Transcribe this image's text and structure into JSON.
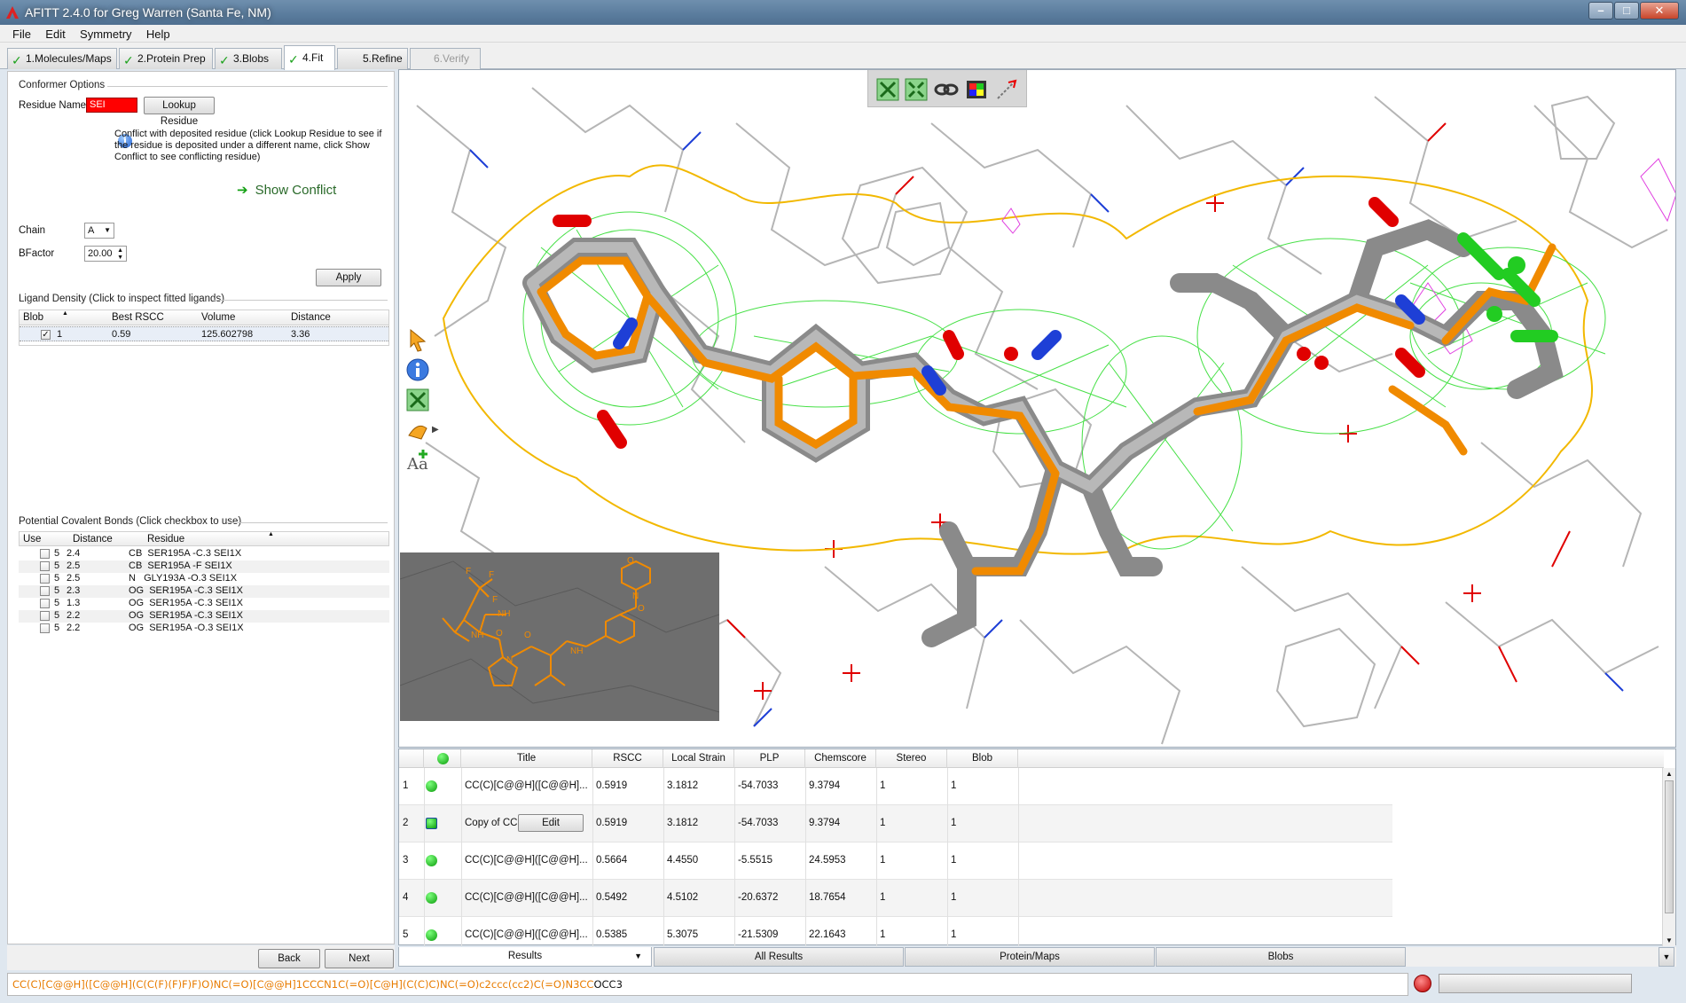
{
  "window": {
    "title": "AFITT 2.4.0 for Greg Warren (Santa Fe, NM)",
    "min": "–",
    "max": "□",
    "close": "✕"
  },
  "menu": [
    "File",
    "Edit",
    "Symmetry",
    "Help"
  ],
  "steps": [
    {
      "label": "1.Molecules/Maps",
      "checked": true
    },
    {
      "label": "2.Protein Prep",
      "checked": true
    },
    {
      "label": "3.Blobs",
      "checked": true
    },
    {
      "label": "4.Fit",
      "checked": true
    },
    {
      "label": "5.Refine",
      "checked": false
    },
    {
      "label": "6.Verify",
      "checked": false
    }
  ],
  "conformer": {
    "section_title": "Conformer Options",
    "residue_label": "Residue Name",
    "residue_value": "SEI",
    "lookup_button": "Lookup Residue",
    "info_text": "Conflict with deposited residue (click Lookup Residue to see if the residue is deposited under a different name, click Show Conflict to see conflicting residue)",
    "show_conflict": "Show Conflict",
    "chain_label": "Chain",
    "chain_value": "A",
    "bfactor_label": "BFactor",
    "bfactor_value": "20.00",
    "apply_button": "Apply"
  },
  "density": {
    "section_title": "Ligand Density (Click to inspect fitted ligands)",
    "columns": [
      "Blob",
      "Best RSCC",
      "Volume",
      "Distance"
    ],
    "rows": [
      {
        "blob": "1",
        "rscc": "0.59",
        "volume": "125.602798",
        "distance": "3.36",
        "checked": true
      }
    ]
  },
  "covalent": {
    "section_title": "Potential Covalent Bonds (Click checkbox to use)",
    "columns": [
      "Use",
      "Distance",
      "Residue"
    ],
    "rows": [
      {
        "n": "5",
        "dist": "2.4",
        "residue": "CB  SER195A -C.3 SEI1X"
      },
      {
        "n": "5",
        "dist": "2.5",
        "residue": "CB  SER195A -F SEI1X"
      },
      {
        "n": "5",
        "dist": "2.5",
        "residue": "N   GLY193A -O.3 SEI1X"
      },
      {
        "n": "5",
        "dist": "2.3",
        "residue": "OG  SER195A -C.3 SEI1X"
      },
      {
        "n": "5",
        "dist": "1.3",
        "residue": "OG  SER195A -C.3 SEI1X"
      },
      {
        "n": "5",
        "dist": "2.2",
        "residue": "OG  SER195A -C.3 SEI1X"
      },
      {
        "n": "5",
        "dist": "2.2",
        "residue": "OG  SER195A -O.3 SEI1X"
      }
    ]
  },
  "nav": {
    "back": "Back",
    "next": "Next"
  },
  "sketch_labels": {
    "F1": "F",
    "F2": "F",
    "F3": "F",
    "NH1": "NH",
    "NH2": "NH",
    "NH3": "NH",
    "N1": "N",
    "N2": "N",
    "O1": "O",
    "O2": "O",
    "O3": "O",
    "O4": "O"
  },
  "results": {
    "columns": [
      "",
      "Title",
      "RSCC",
      "Local Strain",
      "PLP",
      "Chemscore",
      "Stereo",
      "Blob"
    ],
    "edit_button": "Edit",
    "rows": [
      {
        "idx": "1",
        "title": "CC(C)[C@@H]([C@@H]...",
        "rscc": "0.5919",
        "strain": "3.1812",
        "plp": "-54.7033",
        "chem": "9.3794",
        "stereo": "1",
        "blob": "1"
      },
      {
        "idx": "2",
        "title": "Copy of CC(C",
        "rscc": "0.5919",
        "strain": "3.1812",
        "plp": "-54.7033",
        "chem": "9.3794",
        "stereo": "1",
        "blob": "1"
      },
      {
        "idx": "3",
        "title": "CC(C)[C@@H]([C@@H]...",
        "rscc": "0.5664",
        "strain": "4.4550",
        "plp": "-5.5515",
        "chem": "24.5953",
        "stereo": "1",
        "blob": "1"
      },
      {
        "idx": "4",
        "title": "CC(C)[C@@H]([C@@H]...",
        "rscc": "0.5492",
        "strain": "4.5102",
        "plp": "-20.6372",
        "chem": "18.7654",
        "stereo": "1",
        "blob": "1"
      },
      {
        "idx": "5",
        "title": "CC(C)[C@@H]([C@@H]...",
        "rscc": "0.5385",
        "strain": "5.3075",
        "plp": "-21.5309",
        "chem": "22.1643",
        "stereo": "1",
        "blob": "1"
      }
    ]
  },
  "bottom_tabs": [
    "Results",
    "All Results",
    "Protein/Maps",
    "Blobs"
  ],
  "smiles": {
    "colored": "CC(C)[C@@H]([C@@H](C(C(F)(F)F)F)O)NC(=O)[C@@H]1CCCN1C(=O)[C@H](C(C)C)NC(=O)c2ccc(cc2)C(=O)N3CC",
    "tail": "OCC3"
  },
  "colors": {
    "accent_orange": "#f08a00",
    "density_green": "#33dd33",
    "carbon_grey": "#9a9a9a",
    "oxygen_red": "#e00000",
    "nitrogen_blue": "#1e3fd6",
    "contour_yellow": "#f2b800",
    "mesh_magenta": "#e040e0"
  }
}
